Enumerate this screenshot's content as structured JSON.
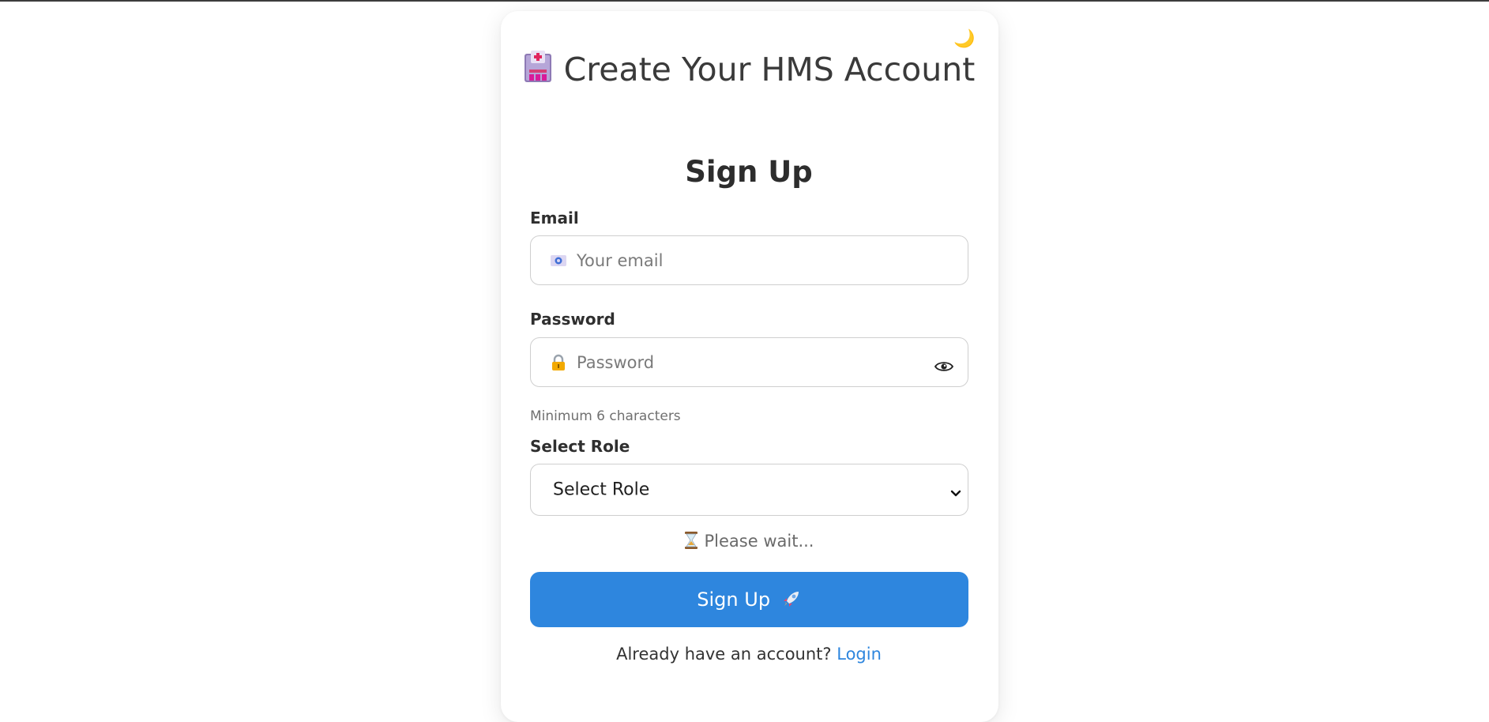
{
  "header": {
    "title": "Create Your HMS Account",
    "subtitle": "Sign Up",
    "theme_icon": "moon-icon",
    "title_icon": "hospital-icon"
  },
  "form": {
    "email": {
      "label": "Email",
      "placeholder": "Your email",
      "value": "",
      "icon": "email-icon"
    },
    "password": {
      "label": "Password",
      "placeholder": "Password",
      "value": "",
      "icon": "lock-icon",
      "toggle_icon": "eye-icon",
      "hint": "Minimum 6 characters"
    },
    "role": {
      "label": "Select Role",
      "selected": "Select Role"
    },
    "status": {
      "text": "Please wait...",
      "icon": "hourglass-icon"
    },
    "submit": {
      "label": "Sign Up",
      "icon": "rocket-icon"
    }
  },
  "footer": {
    "prompt": "Already have an account?",
    "link_label": "Login"
  },
  "colors": {
    "primary": "#2e86de",
    "link": "#2e86de",
    "text": "#333333",
    "muted": "#707070"
  }
}
